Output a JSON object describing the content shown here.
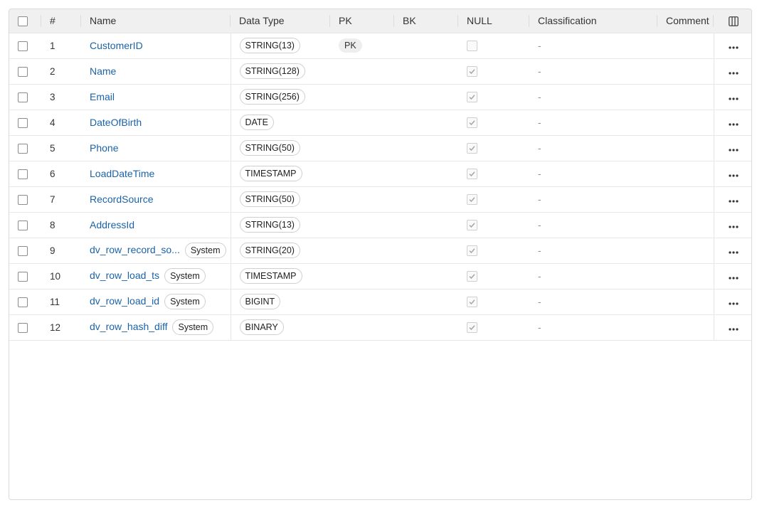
{
  "columns": {
    "num": "#",
    "name": "Name",
    "data_type": "Data Type",
    "pk": "PK",
    "bk": "BK",
    "null": "NULL",
    "classification": "Classification",
    "comment": "Comment"
  },
  "rows": [
    {
      "num": "1",
      "name": "CustomerID",
      "type": "STRING(13)",
      "pk": "PK",
      "nullable": false,
      "classification": "-",
      "system": null
    },
    {
      "num": "2",
      "name": "Name",
      "type": "STRING(128)",
      "pk": null,
      "nullable": true,
      "classification": "-",
      "system": null
    },
    {
      "num": "3",
      "name": "Email",
      "type": "STRING(256)",
      "pk": null,
      "nullable": true,
      "classification": "-",
      "system": null
    },
    {
      "num": "4",
      "name": "DateOfBirth",
      "type": "DATE",
      "pk": null,
      "nullable": true,
      "classification": "-",
      "system": null
    },
    {
      "num": "5",
      "name": "Phone",
      "type": "STRING(50)",
      "pk": null,
      "nullable": true,
      "classification": "-",
      "system": null
    },
    {
      "num": "6",
      "name": "LoadDateTime",
      "type": "TIMESTAMP",
      "pk": null,
      "nullable": true,
      "classification": "-",
      "system": null
    },
    {
      "num": "7",
      "name": "RecordSource",
      "type": "STRING(50)",
      "pk": null,
      "nullable": true,
      "classification": "-",
      "system": null
    },
    {
      "num": "8",
      "name": "AddressId",
      "type": "STRING(13)",
      "pk": null,
      "nullable": true,
      "classification": "-",
      "system": null
    },
    {
      "num": "9",
      "name": "dv_row_record_so...",
      "type": "STRING(20)",
      "pk": null,
      "nullable": true,
      "classification": "-",
      "system": "System"
    },
    {
      "num": "10",
      "name": "dv_row_load_ts",
      "type": "TIMESTAMP",
      "pk": null,
      "nullable": true,
      "classification": "-",
      "system": "System"
    },
    {
      "num": "11",
      "name": "dv_row_load_id",
      "type": "BIGINT",
      "pk": null,
      "nullable": true,
      "classification": "-",
      "system": "System"
    },
    {
      "num": "12",
      "name": "dv_row_hash_diff",
      "type": "BINARY",
      "pk": null,
      "nullable": true,
      "classification": "-",
      "system": "System"
    }
  ],
  "colors": {
    "link": "#1a63a8",
    "header_bg": "#f0f0f0",
    "border": "#d9d9d9"
  },
  "icons": {
    "row_actions": "more-horizontal-icon",
    "column_settings": "columns-icon"
  }
}
